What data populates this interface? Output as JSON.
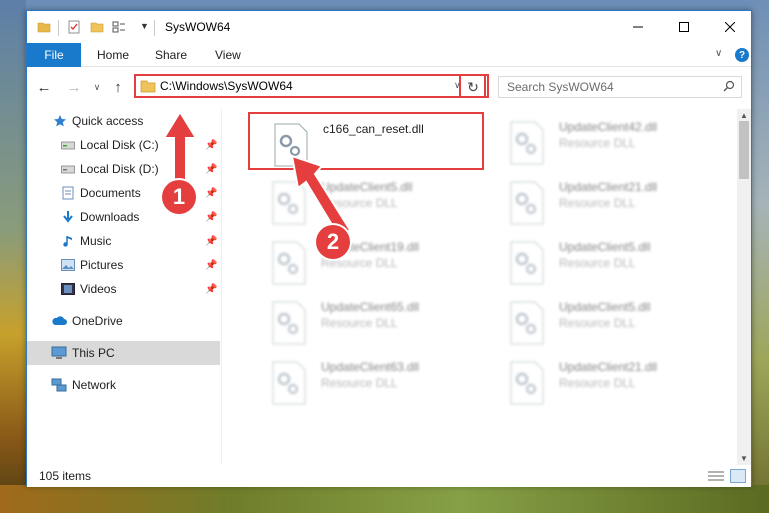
{
  "window": {
    "title": "SysWOW64"
  },
  "ribbon": {
    "tabs": [
      {
        "label": "File"
      },
      {
        "label": "Home"
      },
      {
        "label": "Share"
      },
      {
        "label": "View"
      }
    ]
  },
  "nav": {
    "address": "C:\\Windows\\SysWOW64",
    "search_placeholder": "Search SysWOW64"
  },
  "sidebar": {
    "items": [
      {
        "label": "Quick access",
        "icon": "star-icon"
      },
      {
        "label": "Local Disk (C:)",
        "icon": "drive-icon"
      },
      {
        "label": "Local Disk (D:)",
        "icon": "drive-icon"
      },
      {
        "label": "Documents",
        "icon": "documents-icon"
      },
      {
        "label": "Downloads",
        "icon": "download-icon"
      },
      {
        "label": "Music",
        "icon": "music-icon"
      },
      {
        "label": "Pictures",
        "icon": "pictures-icon"
      },
      {
        "label": "Videos",
        "icon": "videos-icon"
      },
      {
        "label": "OneDrive",
        "icon": "cloud-icon"
      },
      {
        "label": "This PC",
        "icon": "computer-icon"
      },
      {
        "label": "Network",
        "icon": "network-icon"
      }
    ],
    "selected": "This PC"
  },
  "files": [
    {
      "name": "c166_can_reset.dll",
      "type": ""
    },
    {
      "name": "UpdateClient42.dll",
      "type": "Resource DLL"
    },
    {
      "name": "UpdateClient5.dll",
      "type": "Resource DLL"
    },
    {
      "name": "UpdateClient21.dll",
      "type": "Resource DLL"
    },
    {
      "name": "UpdateClient19.dll",
      "type": "Resource DLL"
    },
    {
      "name": "UpdateClient5.dll",
      "type": "Resource DLL"
    },
    {
      "name": "UpdateClient65.dll",
      "type": "Resource DLL"
    },
    {
      "name": "UpdateClient5.dll",
      "type": "Resource DLL"
    },
    {
      "name": "UpdateClient63.dll",
      "type": "Resource DLL"
    },
    {
      "name": "UpdateClient21.dll",
      "type": "Resource DLL"
    }
  ],
  "status": {
    "item_count": "105 items"
  },
  "annotations": [
    {
      "number": "1"
    },
    {
      "number": "2"
    }
  ],
  "colors": {
    "accent": "#1979ca",
    "highlight": "#e53e3e",
    "selected_bg": "#d9d9d9"
  }
}
